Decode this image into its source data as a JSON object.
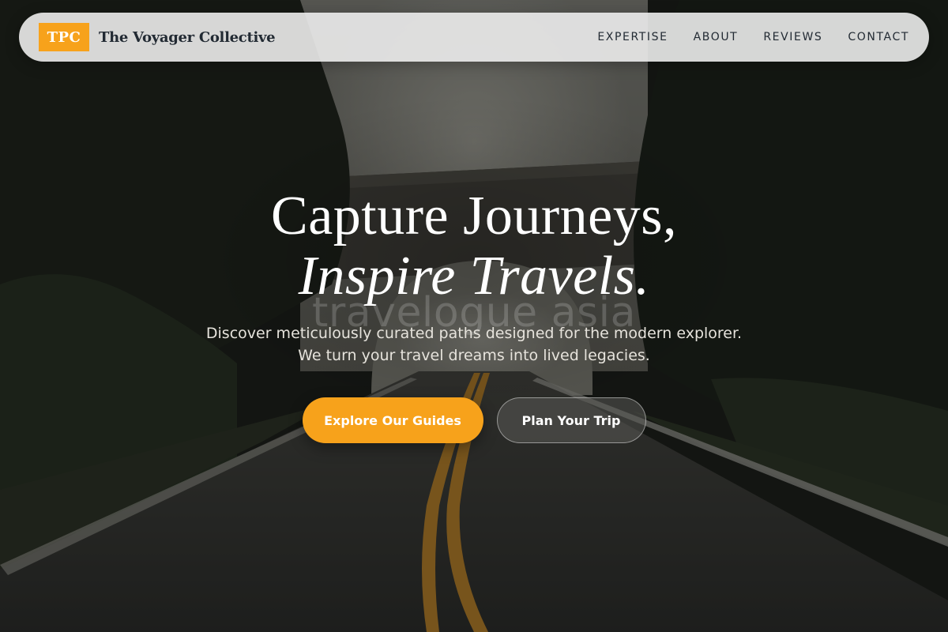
{
  "nav": {
    "logo_text": "TPC",
    "brand_name": "The Voyager Collective",
    "links": [
      {
        "label": "EXPERTISE"
      },
      {
        "label": "ABOUT"
      },
      {
        "label": "REVIEWS"
      },
      {
        "label": "CONTACT"
      }
    ]
  },
  "hero": {
    "headline_line1": "Capture Journeys,",
    "headline_line2": "Inspire Travels.",
    "watermark": "travelogue asia",
    "subtitle_line1": "Discover meticulously curated paths designed for the modern explorer.",
    "subtitle_line2": "We turn your travel dreams into lived legacies.",
    "primary_cta": "Explore Our Guides",
    "secondary_cta": "Plan Your Trip"
  },
  "colors": {
    "accent": "#f7a21b",
    "nav_background": "#ececec",
    "brand_text": "#222a33"
  },
  "background": {
    "scene": "forest road through stone arch bridge"
  }
}
